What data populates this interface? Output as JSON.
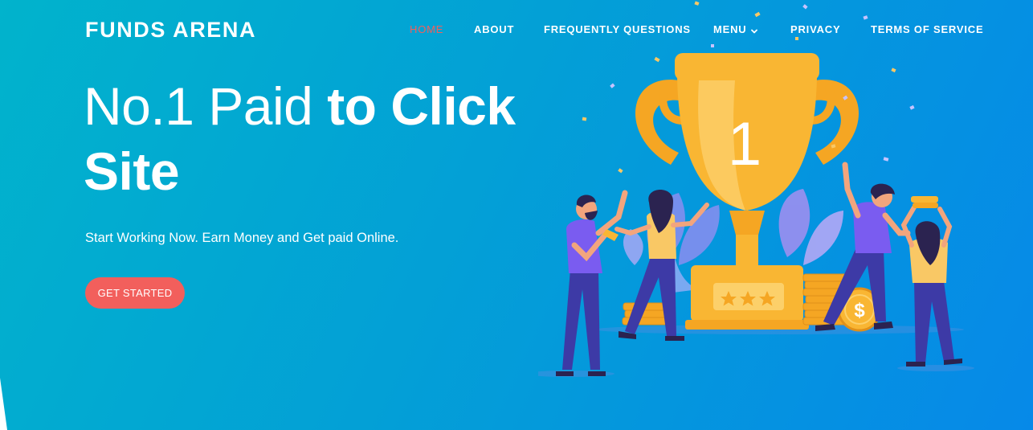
{
  "header": {
    "brand": "FUNDS ARENA",
    "nav": [
      {
        "label": "HOME",
        "active": true
      },
      {
        "label": "ABOUT"
      },
      {
        "label": "FREQUENTLY QUESTIONS"
      },
      {
        "label": "MENU",
        "dropdown": true
      },
      {
        "label": "PRIVACY"
      },
      {
        "label": "TERMS OF SERVICE"
      }
    ]
  },
  "hero": {
    "headline_light": "No.1 Paid ",
    "headline_bold_1": "to Click",
    "headline_bold_2": "Site",
    "subtitle": "Start Working Now. Earn Money and Get paid Online.",
    "cta_label": "GET STARTED"
  },
  "illustration": {
    "trophy_number": "1"
  },
  "colors": {
    "gradient_start": "#01b3cc",
    "gradient_end": "#0689e8",
    "accent": "#f25f5c",
    "text": "#ffffff",
    "trophy": "#f9b633"
  }
}
